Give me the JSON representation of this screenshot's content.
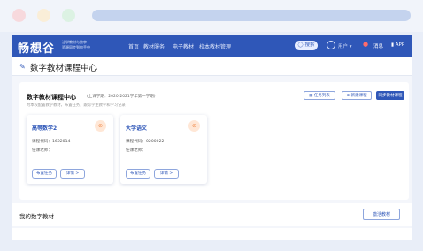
{
  "brand": {
    "logo": "畅想谷",
    "slogan_line1": "让学教材与数字",
    "slogan_line2": "资源同步到你手中"
  },
  "nav": {
    "items": [
      "首页",
      "教材服务",
      "电子教材",
      "校本教材管理"
    ],
    "search_label": "◯ 搜索",
    "user_label": "用户 ▾",
    "message_label": "消息",
    "app_label": "APP"
  },
  "page": {
    "title": "数字教材课程中心"
  },
  "course_center": {
    "title": "数字教材课程中心",
    "subtitle": "(上课学期：2020-2021学年第一学期)",
    "hint": "为本校配置教学教材，布置任务，跟踪学生教学和学习记录",
    "buttons": {
      "task_list": "任务列表",
      "new_course": "⊕ 新建课程",
      "join_course": "同步教材课程"
    },
    "courses": [
      {
        "name": "高等数学2",
        "code_label": "课程代码：",
        "code": "1602014",
        "teacher_label": "任课老师：",
        "teacher": "",
        "assign_label": "布置任务",
        "detail_label": "详情 >"
      },
      {
        "name": "大学语文",
        "code_label": "课程代码：",
        "code": "0200022",
        "teacher_label": "任课老师：",
        "teacher": "",
        "assign_label": "布置任务",
        "detail_label": "详情 >"
      }
    ]
  },
  "my_materials": {
    "title": "我的数字教材",
    "activate_label": "激活教材"
  },
  "colors": {
    "primary": "#2f57b8",
    "accent_orange": "#f08a4b",
    "background": "#e9eef8"
  }
}
